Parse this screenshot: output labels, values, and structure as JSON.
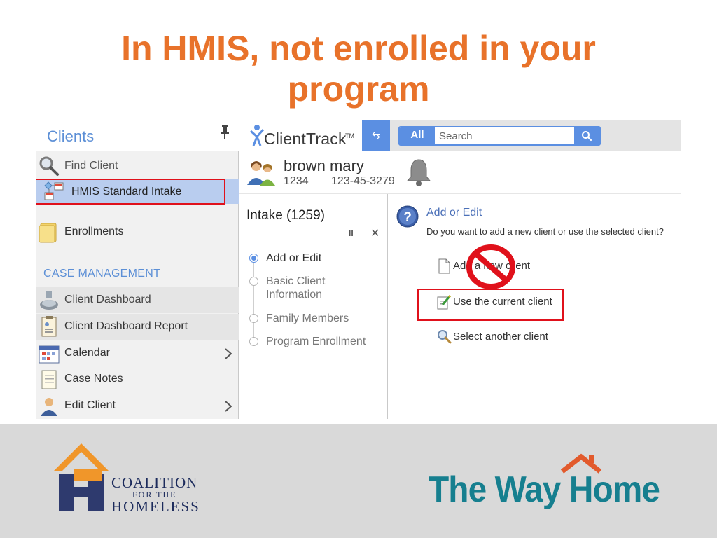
{
  "slide": {
    "title_line1": "In HMIS, not enrolled in your",
    "title_line2": "program",
    "accent_color": "#e8722a"
  },
  "sidebar": {
    "title": "Clients",
    "items": [
      {
        "label": "Find Client",
        "icon": "magnifier-icon"
      },
      {
        "label": "HMIS Standard Intake",
        "icon": "workflow-icon",
        "selected": true,
        "highlighted": true
      },
      {
        "label": "Enrollments",
        "icon": "folder-icon"
      }
    ],
    "section_heading": "CASE MANAGEMENT",
    "case_items": [
      {
        "label": "Client Dashboard",
        "icon": "dashboard-icon"
      },
      {
        "label": "Client Dashboard Report",
        "icon": "report-icon"
      },
      {
        "label": "Calendar",
        "icon": "calendar-icon",
        "has_submenu": true
      },
      {
        "label": "Case Notes",
        "icon": "notes-icon"
      },
      {
        "label": "Edit Client",
        "icon": "person-icon",
        "has_submenu": true
      }
    ]
  },
  "header": {
    "logo_text": "ClientTrack",
    "logo_tm": "TM",
    "swap_label": "⇆",
    "search": {
      "scope": "All",
      "placeholder": "Search"
    }
  },
  "client": {
    "name": "brown mary",
    "id": "1234",
    "ssn": "123-45-3279"
  },
  "intake": {
    "title": "Intake (1259)",
    "pause_label": "II",
    "close_label": "✕",
    "steps": [
      {
        "label": "Add or Edit",
        "active": true
      },
      {
        "label": "Basic Client Information",
        "active": false
      },
      {
        "label": "Family Members",
        "active": false
      },
      {
        "label": "Program Enrollment",
        "active": false
      }
    ]
  },
  "content": {
    "section_title": "Add or Edit",
    "question": "Do you want to add a new client or use the selected client?",
    "options": [
      {
        "label": "Add a new client",
        "icon": "page-icon",
        "crossed_out": true
      },
      {
        "label": "Use the current client",
        "icon": "edit-page-icon",
        "highlighted": true
      },
      {
        "label": "Select another client",
        "icon": "magnifier-icon"
      }
    ]
  },
  "footer": {
    "coalition": {
      "line1": "COALITION",
      "line2": "FOR THE",
      "line3": "HOMELESS"
    },
    "twh": {
      "text": "The Way Home",
      "color": "#167f8f",
      "roof_color": "#e25a2c"
    }
  }
}
